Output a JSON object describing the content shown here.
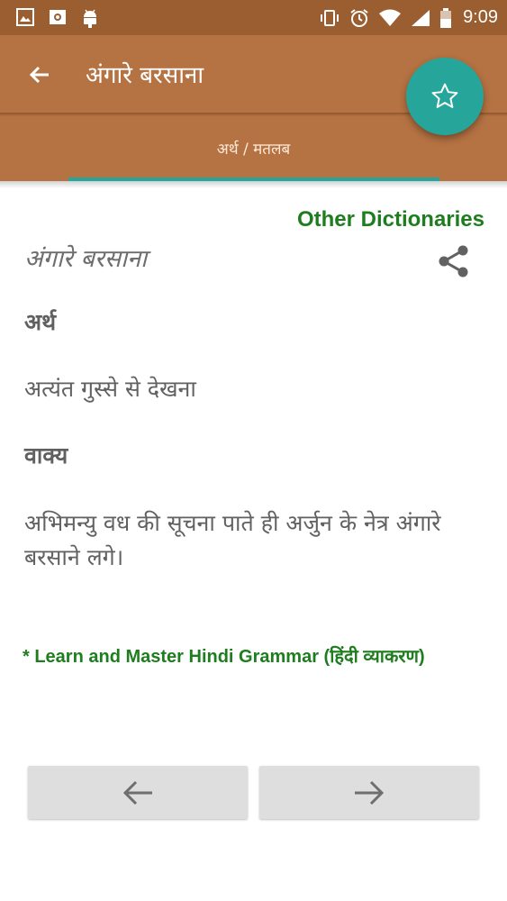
{
  "status_bar": {
    "time": "9:09",
    "left_icons": [
      "image-icon",
      "camera-icon",
      "android-icon"
    ],
    "right_icons": [
      "vibrate-icon",
      "alarm-icon",
      "wifi-icon",
      "signal-icon",
      "battery-icon"
    ]
  },
  "toolbar": {
    "title": "अंगारे बरसाना",
    "back_icon": "arrow-back-icon",
    "fab_icon": "star-outline-icon"
  },
  "tabs": [
    {
      "label": "अर्थ / मतलब",
      "selected": true
    }
  ],
  "content": {
    "other_dictionaries_link": "Other Dictionaries",
    "word": "अंगारे बरसाना",
    "share_icon": "share-icon",
    "meaning_heading": "अर्थ",
    "meaning_text": "अत्यंत गुस्से से देखना",
    "sentence_heading": "वाक्य",
    "sentence_text": "अभिमन्यु वध की सूचना पाते ही अर्जुन के नेत्र अंगारे बरसाने लगे।",
    "promo_link": "* Learn and Master Hindi Grammar (हिंदी व्याकरण)"
  },
  "navigation": {
    "prev_icon": "arrow-left-icon",
    "next_icon": "arrow-right-icon"
  },
  "colors": {
    "toolbar": "#b57242",
    "status_bar": "#9a5e30",
    "accent": "#26a69a",
    "link_green": "#1e7d1e",
    "text_gray": "#616161",
    "nav_button": "#dedede"
  }
}
